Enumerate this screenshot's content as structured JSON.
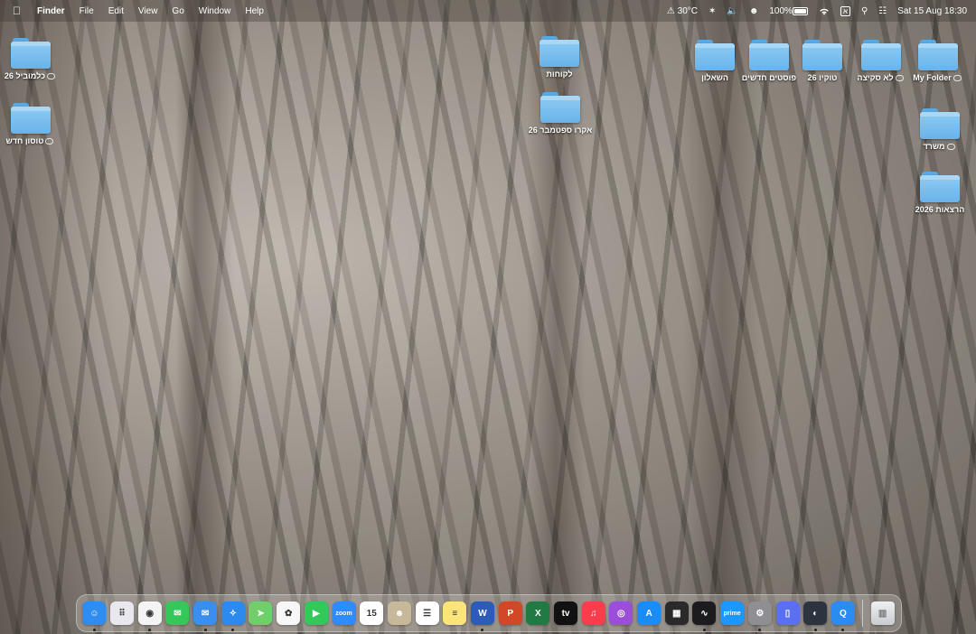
{
  "menubar": {
    "apple": "",
    "app_name": "Finder",
    "menus": [
      "File",
      "Edit",
      "View",
      "Go",
      "Window",
      "Help"
    ],
    "weather": "30°C",
    "battery_percent": "100%",
    "keyboard": "א",
    "datetime": "Sat 15 Aug  18:30"
  },
  "desktop": {
    "folders": [
      {
        "label": "כלמוביל 26",
        "cloud": true
      },
      {
        "label": "טוסון חדש",
        "cloud": true
      },
      {
        "label": "לקוחות",
        "cloud": false
      },
      {
        "label": "אקרו ספטמבר 26",
        "cloud": false
      },
      {
        "label": "השאלון",
        "cloud": false
      },
      {
        "label": "פוסטים חדשים",
        "cloud": false
      },
      {
        "label": "טוקיו 26",
        "cloud": false
      },
      {
        "label": "לא סקיצה",
        "cloud": true
      },
      {
        "label": "My Folder",
        "cloud": true
      },
      {
        "label": "משרד",
        "cloud": true
      },
      {
        "label": "הרצאות 2026",
        "cloud": false
      }
    ]
  },
  "dock": {
    "apps": [
      {
        "name": "Finder",
        "icon": "finder-icon",
        "color": "#2f8cf0",
        "glyph": "☺",
        "running": true
      },
      {
        "name": "Launchpad",
        "icon": "launchpad-icon",
        "color": "#e8e8ee",
        "glyph": "⠿",
        "running": false
      },
      {
        "name": "Chrome",
        "icon": "chrome-icon",
        "color": "#f4f4f4",
        "glyph": "◉",
        "running": true
      },
      {
        "name": "Messages",
        "icon": "messages-icon",
        "color": "#35c759",
        "glyph": "✉",
        "running": false
      },
      {
        "name": "Mail",
        "icon": "mail-icon",
        "color": "#3a8ef0",
        "glyph": "✉",
        "running": true
      },
      {
        "name": "Safari",
        "icon": "safari-icon",
        "color": "#2b8af0",
        "glyph": "✧",
        "running": true
      },
      {
        "name": "Maps",
        "icon": "maps-icon",
        "color": "#6fcf6a",
        "glyph": "➤",
        "running": false
      },
      {
        "name": "Photos",
        "icon": "photos-icon",
        "color": "#f7f7f7",
        "glyph": "✿",
        "running": false
      },
      {
        "name": "FaceTime",
        "icon": "facetime-icon",
        "color": "#34c759",
        "glyph": "▶",
        "running": false
      },
      {
        "name": "Zoom",
        "icon": "zoom-icon",
        "color": "#2d8cff",
        "glyph": "zoom",
        "running": false
      },
      {
        "name": "Calendar",
        "icon": "calendar-icon",
        "color": "#ffffff",
        "glyph": "15",
        "running": false
      },
      {
        "name": "Contacts",
        "icon": "contacts-icon",
        "color": "#c8b89a",
        "glyph": "☻",
        "running": false
      },
      {
        "name": "Reminders",
        "icon": "reminders-icon",
        "color": "#ffffff",
        "glyph": "☰",
        "running": false
      },
      {
        "name": "Notes",
        "icon": "notes-icon",
        "color": "#fbe57a",
        "glyph": "≡",
        "running": false
      },
      {
        "name": "Word",
        "icon": "word-icon",
        "color": "#2b5cb8",
        "glyph": "W",
        "running": true
      },
      {
        "name": "PowerPoint",
        "icon": "powerpoint-icon",
        "color": "#d24726",
        "glyph": "P",
        "running": false
      },
      {
        "name": "Excel",
        "icon": "excel-icon",
        "color": "#1f7a44",
        "glyph": "X",
        "running": false
      },
      {
        "name": "Apple TV",
        "icon": "appletv-icon",
        "color": "#111111",
        "glyph": "tv",
        "running": false
      },
      {
        "name": "Music",
        "icon": "music-icon",
        "color": "#fa3c4c",
        "glyph": "♫",
        "running": false
      },
      {
        "name": "Podcasts",
        "icon": "podcasts-icon",
        "color": "#9b4fd8",
        "glyph": "◎",
        "running": false
      },
      {
        "name": "App Store",
        "icon": "appstore-icon",
        "color": "#1b8cf5",
        "glyph": "A",
        "running": false
      },
      {
        "name": "Photo Editor",
        "icon": "photo-editor-icon",
        "color": "#2a2a2a",
        "glyph": "▦",
        "running": false
      },
      {
        "name": "Stocks",
        "icon": "stocks-icon",
        "color": "#1c1c1e",
        "glyph": "∿",
        "running": true
      },
      {
        "name": "Prime Video",
        "icon": "primevideo-icon",
        "color": "#1a98ff",
        "glyph": "prime",
        "running": false
      },
      {
        "name": "System Settings",
        "icon": "settings-icon",
        "color": "#8e8e93",
        "glyph": "⚙",
        "running": true
      },
      {
        "name": "Simulator",
        "icon": "simulator-icon",
        "color": "#5b6ff2",
        "glyph": "▯",
        "running": false
      },
      {
        "name": "Utility",
        "icon": "utility-icon",
        "color": "#2c3440",
        "glyph": "◐",
        "running": true
      },
      {
        "name": "Qobuz",
        "icon": "qobuz-icon",
        "color": "#2a8cf0",
        "glyph": "Q",
        "running": true
      }
    ],
    "trash": {
      "name": "Trash",
      "icon": "trash-icon"
    }
  }
}
